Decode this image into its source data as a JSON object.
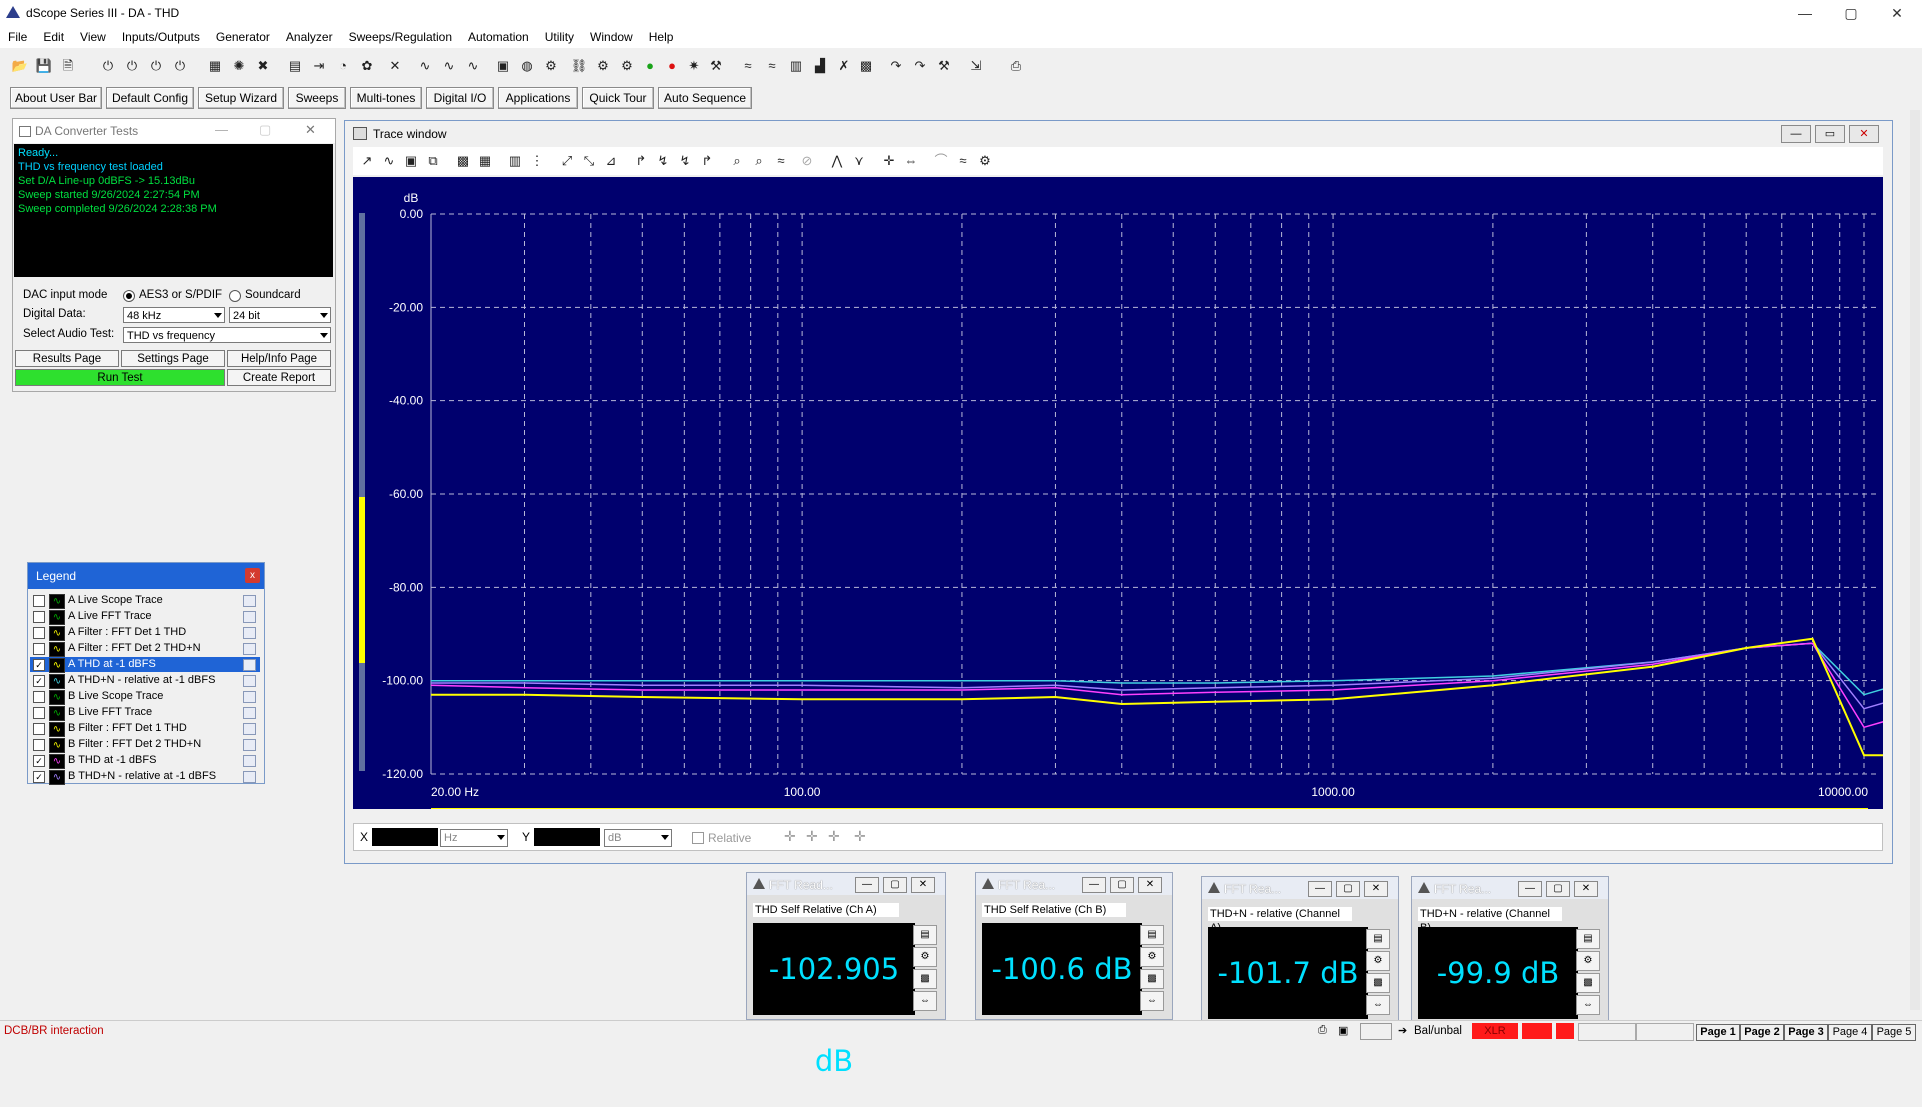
{
  "window": {
    "title": "dScope Series III - DA - THD",
    "min": "—",
    "max": "▢",
    "close": "✕"
  },
  "menu": [
    "File",
    "Edit",
    "View",
    "Inputs/Outputs",
    "Generator",
    "Analyzer",
    "Sweeps/Regulation",
    "Automation",
    "Utility",
    "Window",
    "Help"
  ],
  "appbar": [
    "About User Bar",
    "Default Config",
    "Setup Wizard",
    "Sweeps",
    "Multi-tones",
    "Digital I/O",
    "Applications",
    "Quick Tour",
    "Auto Sequence"
  ],
  "da": {
    "title": "DA Converter Tests",
    "console": {
      "ready": "Ready...",
      "loaded": "THD vs frequency test loaded",
      "lineup": "Set D/A Line-up 0dBFS -> 15.13dBu",
      "started": "Sweep started 9/26/2024 2:27:54 PM",
      "completed": "Sweep completed 9/26/2024 2:28:38 PM"
    },
    "dac_mode_label": "DAC input mode",
    "opt_aes": "AES3 or S/PDIF",
    "opt_sound": "Soundcard",
    "digital_label": "Digital Data:",
    "rate": "48 kHz",
    "bits": "24 bit",
    "test_label": "Select Audio Test:",
    "test": "THD vs frequency",
    "results": "Results Page",
    "settings": "Settings Page",
    "help": "Help/Info Page",
    "run": "Run Test",
    "report": "Create Report"
  },
  "legend": {
    "title": "Legend",
    "close": "x",
    "items": [
      {
        "label": "A  Live Scope Trace",
        "checked": false
      },
      {
        "label": "A  Live FFT Trace",
        "checked": false
      },
      {
        "label": "A  Filter : FFT Det 1 THD",
        "checked": false
      },
      {
        "label": "A  Filter : FFT Det 2  THD+N",
        "checked": false
      },
      {
        "label": "A   THD  at -1 dBFS",
        "checked": true
      },
      {
        "label": "A   THD+N - relative  at -1 dBFS",
        "checked": true
      },
      {
        "label": "B  Live Scope Trace",
        "checked": false
      },
      {
        "label": "B  Live FFT Trace",
        "checked": false
      },
      {
        "label": "B  Filter : FFT Det 1 THD",
        "checked": false
      },
      {
        "label": "B  Filter : FFT Det 2 THD+N",
        "checked": false
      },
      {
        "label": "B   THD  at -1 dBFS",
        "checked": true
      },
      {
        "label": "B   THD+N - relative  at -1 dBFS",
        "checked": true
      }
    ]
  },
  "trace": {
    "title": "Trace window",
    "x_label": "X",
    "x_unit": "Hz",
    "y_label": "Y",
    "y_unit": "dB",
    "relative": "Relative"
  },
  "chart_data": {
    "type": "line",
    "ylabel": "dB",
    "ylim": [
      -120,
      0
    ],
    "xscale": "log",
    "xlim": [
      20,
      12000
    ],
    "yticks": [
      "0.00",
      "-20.00",
      "-40.00",
      "-60.00",
      "-80.00",
      "-100.00",
      "-120.00"
    ],
    "xticks": [
      "20.00 Hz",
      "100.00",
      "1000.00",
      "10000.00"
    ],
    "series": [
      {
        "color": "#ffff00",
        "x": [
          20,
          30,
          50,
          100,
          200,
          300,
          400,
          600,
          1000,
          2000,
          4000,
          6000,
          8000,
          10000,
          12000
        ],
        "y": [
          -103,
          -103,
          -103.5,
          -104,
          -104,
          -103.5,
          -105,
          -104.5,
          -104,
          -101,
          -97,
          -93,
          -91,
          -116,
          -116
        ]
      },
      {
        "color": "#ff40ff",
        "x": [
          20,
          30,
          50,
          100,
          200,
          300,
          400,
          600,
          1000,
          2000,
          4000,
          6000,
          8000,
          10000,
          12000
        ],
        "y": [
          -101,
          -101.5,
          -102,
          -102,
          -102,
          -101.5,
          -103,
          -102.5,
          -102,
          -100,
          -96.5,
          -93,
          -92,
          -110,
          -108
        ]
      },
      {
        "color": "#a080ff",
        "x": [
          20,
          30,
          50,
          100,
          200,
          300,
          400,
          600,
          1000,
          2000,
          4000,
          6000,
          8000,
          10000,
          12000
        ],
        "y": [
          -100.5,
          -100.5,
          -101,
          -101,
          -101.5,
          -101,
          -102,
          -101.5,
          -101,
          -99.5,
          -96,
          -93,
          -92,
          -106,
          -104
        ]
      },
      {
        "color": "#40d0e0",
        "x": [
          20,
          30,
          50,
          100,
          200,
          300,
          400,
          600,
          1000,
          2000,
          4000,
          6000,
          8000,
          10000,
          12000
        ],
        "y": [
          -100,
          -100,
          -100,
          -100,
          -100,
          -100,
          -100.5,
          -100.5,
          -100,
          -99,
          -96,
          -93,
          -92,
          -103,
          -101
        ]
      }
    ]
  },
  "meters": [
    {
      "title": "FFT Read...",
      "sub": "THD Self Relative (Ch A)",
      "value": "-102.905 dB"
    },
    {
      "title": "FFT Rea...",
      "sub": "THD Self Relative (Ch B)",
      "value": "-100.6 dB"
    },
    {
      "title": "FFT Rea...",
      "sub": "THD+N - relative (Channel A)",
      "value": "-101.7 dB"
    },
    {
      "title": "FFT Rea...",
      "sub": "THD+N - relative (Channel B)",
      "value": "-99.9 dB"
    }
  ],
  "status": {
    "left": "DCB/BR interaction",
    "balunbal": "Bal/unbal",
    "xlr": "XLR",
    "pages": [
      "Page 1",
      "Page 2",
      "Page 3",
      "Page 4",
      "Page 5"
    ]
  }
}
